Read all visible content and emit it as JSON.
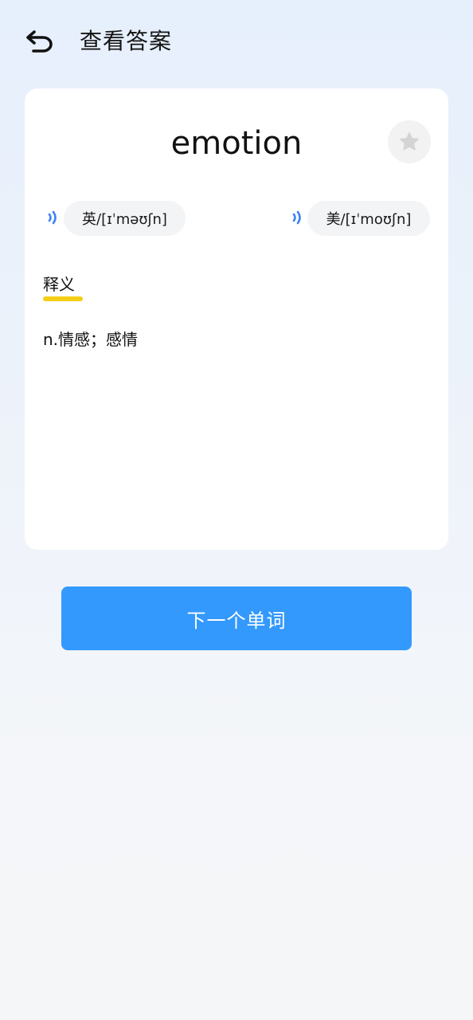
{
  "header": {
    "back_icon": "back-arrow-icon",
    "title": "查看答案"
  },
  "card": {
    "word": "emotion",
    "favorite_icon": "star-icon",
    "pronunciations": {
      "uk": {
        "label": "英/[ɪˈməʊʃn]",
        "icon": "speaker-icon"
      },
      "us": {
        "label": "美/[ɪˈmoʊʃn]",
        "icon": "speaker-icon"
      }
    },
    "section_label": "释义",
    "definition": "n.情感；感情"
  },
  "next_button": {
    "label": "下一个单词"
  },
  "colors": {
    "accent": "#3399fd",
    "underline": "#f5cf16",
    "speaker": "#3b82f6",
    "star": "#d4d4d4"
  }
}
